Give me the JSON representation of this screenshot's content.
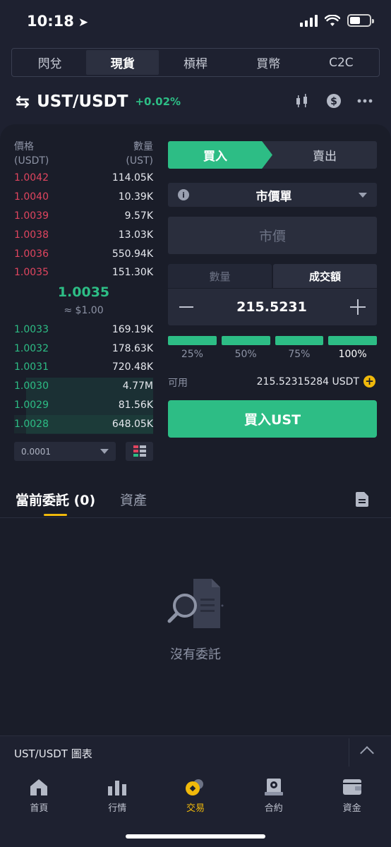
{
  "status": {
    "time": "10:18"
  },
  "top_tabs": [
    "閃兌",
    "現貨",
    "槓桿",
    "買幣",
    "C2C"
  ],
  "pair": {
    "name": "UST/USDT",
    "change": "+0.02%"
  },
  "orderbook": {
    "price_header": "價格",
    "price_unit": "(USDT)",
    "qty_header": "數量",
    "qty_unit": "(UST)",
    "asks": [
      {
        "price": "1.0042",
        "qty": "114.05K"
      },
      {
        "price": "1.0040",
        "qty": "10.39K"
      },
      {
        "price": "1.0039",
        "qty": "9.57K"
      },
      {
        "price": "1.0038",
        "qty": "13.03K"
      },
      {
        "price": "1.0036",
        "qty": "550.94K"
      },
      {
        "price": "1.0035",
        "qty": "151.30K"
      }
    ],
    "mid_price": "1.0035",
    "mid_usd": "≈ $1.00",
    "bids": [
      {
        "price": "1.0033",
        "qty": "169.19K"
      },
      {
        "price": "1.0032",
        "qty": "178.63K"
      },
      {
        "price": "1.0031",
        "qty": "720.48K"
      },
      {
        "price": "1.0030",
        "qty": "4.77M"
      },
      {
        "price": "1.0029",
        "qty": "81.56K"
      },
      {
        "price": "1.0028",
        "qty": "648.05K"
      }
    ],
    "precision": "0.0001"
  },
  "form": {
    "buy_label": "買入",
    "sell_label": "賣出",
    "order_type": "市價單",
    "price_placeholder": "市價",
    "qty_tab": "數量",
    "amount_tab": "成交額",
    "amount_value": "215.5231",
    "percentages": [
      "25%",
      "50%",
      "75%",
      "100%"
    ],
    "available_label": "可用",
    "available_value": "215.52315284 USDT",
    "submit_label": "買入UST"
  },
  "orders": {
    "tab_open": "當前委託 (0)",
    "tab_assets": "資產",
    "empty_text": "沒有委託"
  },
  "chart_bar": {
    "label": "UST/USDT 圖表"
  },
  "nav": [
    "首頁",
    "行情",
    "交易",
    "合約",
    "資金"
  ],
  "colors": {
    "buy": "#2dbd85",
    "sell": "#e0455f",
    "accent": "#f0b90b"
  }
}
